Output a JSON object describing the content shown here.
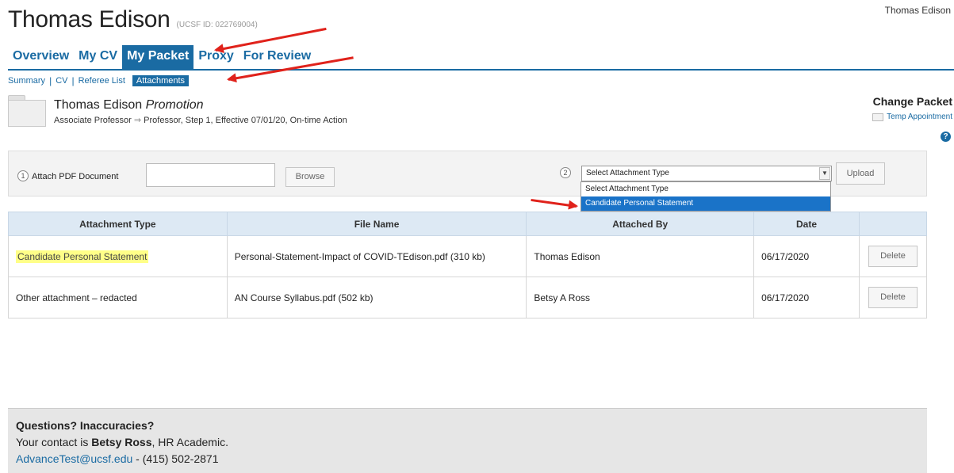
{
  "header": {
    "title": "Thomas Edison",
    "ucsf_id": "(UCSF ID: 022769004)",
    "user_name": "Thomas Edison"
  },
  "main_tabs": [
    {
      "label": "Overview"
    },
    {
      "label": "My CV"
    },
    {
      "label": "My Packet",
      "active": true
    },
    {
      "label": "Proxy"
    },
    {
      "label": "For Review"
    }
  ],
  "sub_tabs": [
    {
      "label": "Summary"
    },
    {
      "label": "CV"
    },
    {
      "label": "Referee List"
    },
    {
      "label": "Attachments",
      "active": true
    }
  ],
  "packet": {
    "name": "Thomas Edison",
    "action": "Promotion",
    "from": "Associate Professor",
    "description": "Professor, Step 1, Effective 07/01/20, On-time Action"
  },
  "change_packet": {
    "title": "Change Packet",
    "link": "Temp Appointment",
    "help": "?"
  },
  "attach_form": {
    "step1": "1",
    "step1_label": "Attach PDF Document",
    "browse_label": "Browse",
    "step2": "2",
    "select_value": "Select Attachment Type",
    "upload_label": "Upload",
    "dropdown_options": [
      "Select Attachment Type",
      "Candidate Personal Statement"
    ]
  },
  "table": {
    "headers": [
      "Attachment Type",
      "File Name",
      "Attached By",
      "Date",
      ""
    ],
    "rows": [
      {
        "type": "Candidate Personal Statement",
        "file": "Personal-Statement-Impact of COVID-TEdison.pdf (310 kb)",
        "by": "Thomas Edison",
        "date": "06/17/2020",
        "action": "Delete"
      },
      {
        "type": "Other attachment – redacted",
        "file": "AN Course Syllabus.pdf (502 kb)",
        "by": "Betsy A Ross",
        "date": "06/17/2020",
        "action": "Delete"
      }
    ]
  },
  "footer": {
    "heading": "Questions? Inaccuracies?",
    "contact_prefix": "Your contact is ",
    "contact_name": "Betsy Ross",
    "contact_suffix": ", HR Academic.",
    "email": "AdvanceTest@ucsf.edu",
    "phone": " - (415) 502-2871"
  },
  "colors": {
    "accent": "#1a6ba3",
    "highlight": "#ffff88",
    "annotation_arrow": "#e0221b"
  }
}
